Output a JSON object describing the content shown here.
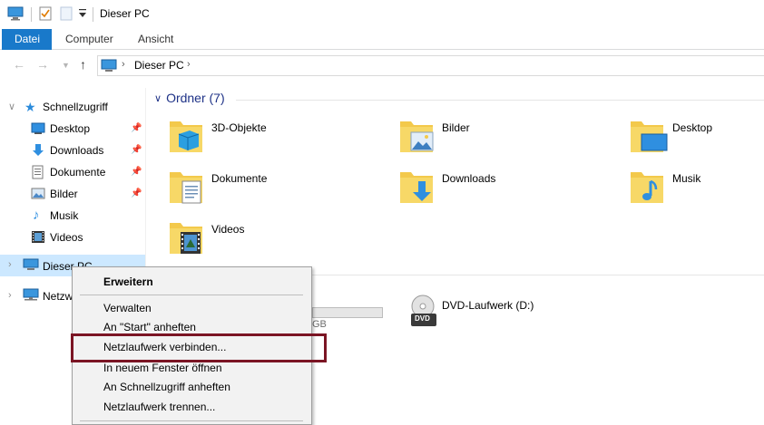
{
  "window": {
    "title": "Dieser PC"
  },
  "ribbon": {
    "tabs": [
      {
        "label": "Datei",
        "active": true
      },
      {
        "label": "Computer",
        "active": false
      },
      {
        "label": "Ansicht",
        "active": false
      }
    ]
  },
  "address": {
    "location": "Dieser PC"
  },
  "navpane": {
    "quick_access": "Schnellzugriff",
    "quick_items": [
      {
        "label": "Desktop",
        "icon": "desktop-icon",
        "pinned": true
      },
      {
        "label": "Downloads",
        "icon": "downloads-icon",
        "pinned": true
      },
      {
        "label": "Dokumente",
        "icon": "documents-icon",
        "pinned": true
      },
      {
        "label": "Bilder",
        "icon": "pictures-icon",
        "pinned": true
      },
      {
        "label": "Musik",
        "icon": "music-icon",
        "pinned": false
      },
      {
        "label": "Videos",
        "icon": "videos-icon",
        "pinned": false
      }
    ],
    "this_pc": "Dieser PC",
    "network": "Netzw"
  },
  "content": {
    "folders_header": "Ordner (7)",
    "folders": [
      {
        "label": "3D-Objekte",
        "icon": "3d-objects-icon"
      },
      {
        "label": "Bilder",
        "icon": "pictures-folder-icon"
      },
      {
        "label": "Desktop",
        "icon": "desktop-folder-icon"
      },
      {
        "label": "Dokumente",
        "icon": "documents-folder-icon"
      },
      {
        "label": "Downloads",
        "icon": "downloads-folder-icon"
      },
      {
        "label": "Musik",
        "icon": "music-folder-icon"
      },
      {
        "label": "Videos",
        "icon": "videos-folder-icon"
      }
    ],
    "drives_header_tail": ")",
    "drive_size_tail": "GB",
    "dvd_label": "DVD-Laufwerk (D:)",
    "dvd_badge": "DVD"
  },
  "context_menu": {
    "items": [
      {
        "label": "Erweitern",
        "bold": true
      },
      {
        "label": "Verwalten",
        "bold": false
      },
      {
        "label": "An \"Start\" anheften",
        "bold": false
      },
      {
        "label": "Netzlaufwerk verbinden...",
        "bold": false
      },
      {
        "label": "In neuem Fenster öffnen",
        "bold": false
      },
      {
        "label": "An Schnellzugriff anheften",
        "bold": false
      },
      {
        "label": "Netzlaufwerk trennen...",
        "bold": false
      }
    ]
  },
  "colors": {
    "accent": "#1979ca",
    "selected": "#cce8ff",
    "highlight_box": "#7b1524",
    "group_header": "#1e3287",
    "folder": "#f3c94b"
  }
}
